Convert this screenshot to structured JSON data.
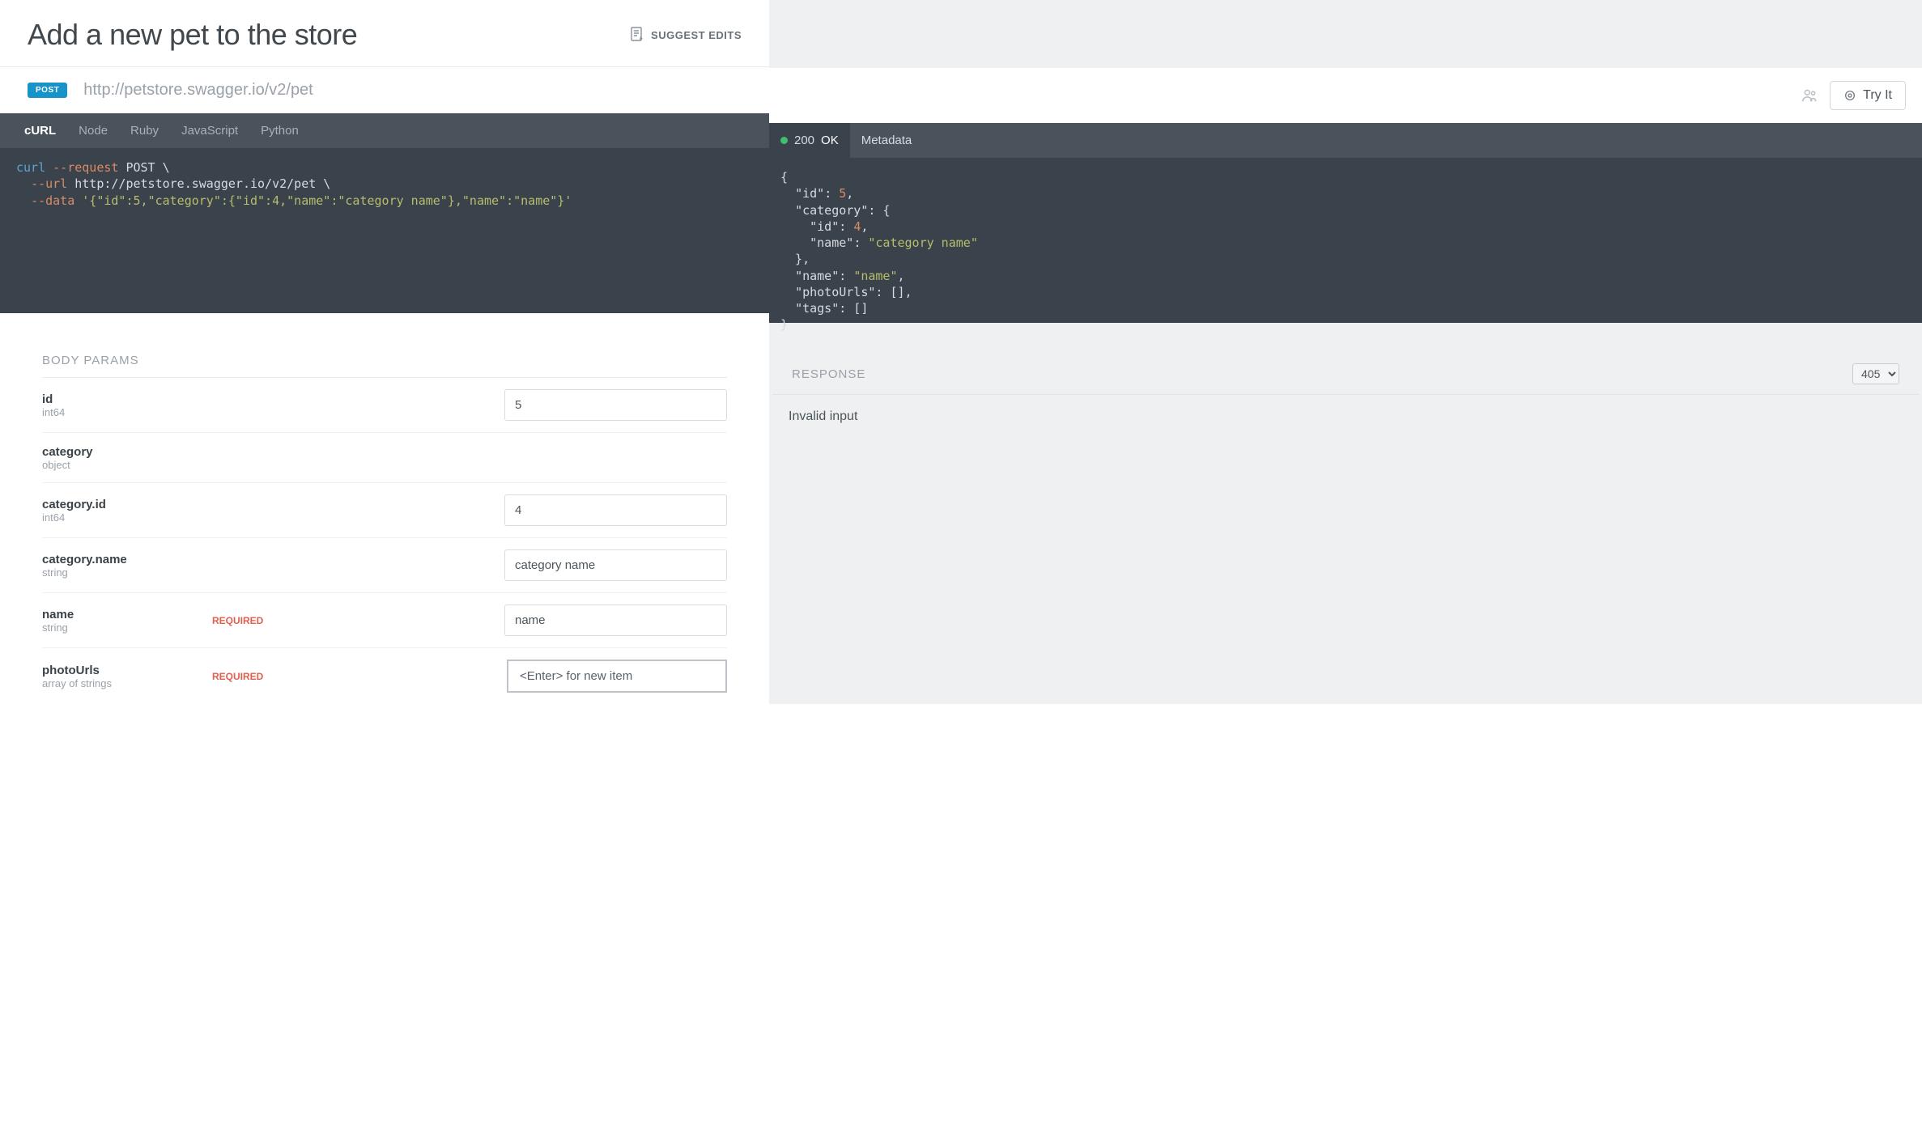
{
  "header": {
    "title": "Add a new pet to the store",
    "suggest_edits": "SUGGEST EDITS"
  },
  "endpoint": {
    "method": "POST",
    "url": "http://petstore.swagger.io/v2/pet",
    "try_it": "Try It"
  },
  "code_tabs": [
    "cURL",
    "Node",
    "Ruby",
    "JavaScript",
    "Python"
  ],
  "code": {
    "curl_cmd": "curl",
    "flag_request": "--request",
    "method": "POST",
    "cont": "\\",
    "flag_url": "--url",
    "url": "http://petstore.swagger.io/v2/pet",
    "flag_data": "--data",
    "data": "'{\"id\":5,\"category\":{\"id\":4,\"name\":\"category name\"},\"name\":\"name\"}'"
  },
  "response_tabs": {
    "status_code": "200",
    "status_text": "OK",
    "metadata": "Metadata"
  },
  "response_json": {
    "id": 5,
    "category_id": 4,
    "category_name": "category name",
    "name": "name"
  },
  "params": {
    "section": "BODY PARAMS",
    "rows": [
      {
        "name": "id",
        "type": "int64",
        "required": "",
        "value": "5",
        "placeholder": ""
      },
      {
        "name": "category",
        "type": "object",
        "required": "",
        "value": "",
        "placeholder": ""
      },
      {
        "name": "category.id",
        "type": "int64",
        "required": "",
        "value": "4",
        "placeholder": ""
      },
      {
        "name": "category.name",
        "type": "string",
        "required": "",
        "value": "category name",
        "placeholder": ""
      },
      {
        "name": "name",
        "type": "string",
        "required": "REQUIRED",
        "value": "name",
        "placeholder": ""
      },
      {
        "name": "photoUrls",
        "type": "array of strings",
        "required": "REQUIRED",
        "value": "",
        "placeholder": "<Enter> for new item"
      }
    ]
  },
  "response_panel": {
    "section": "RESPONSE",
    "code_select": "405",
    "message": "Invalid input"
  }
}
